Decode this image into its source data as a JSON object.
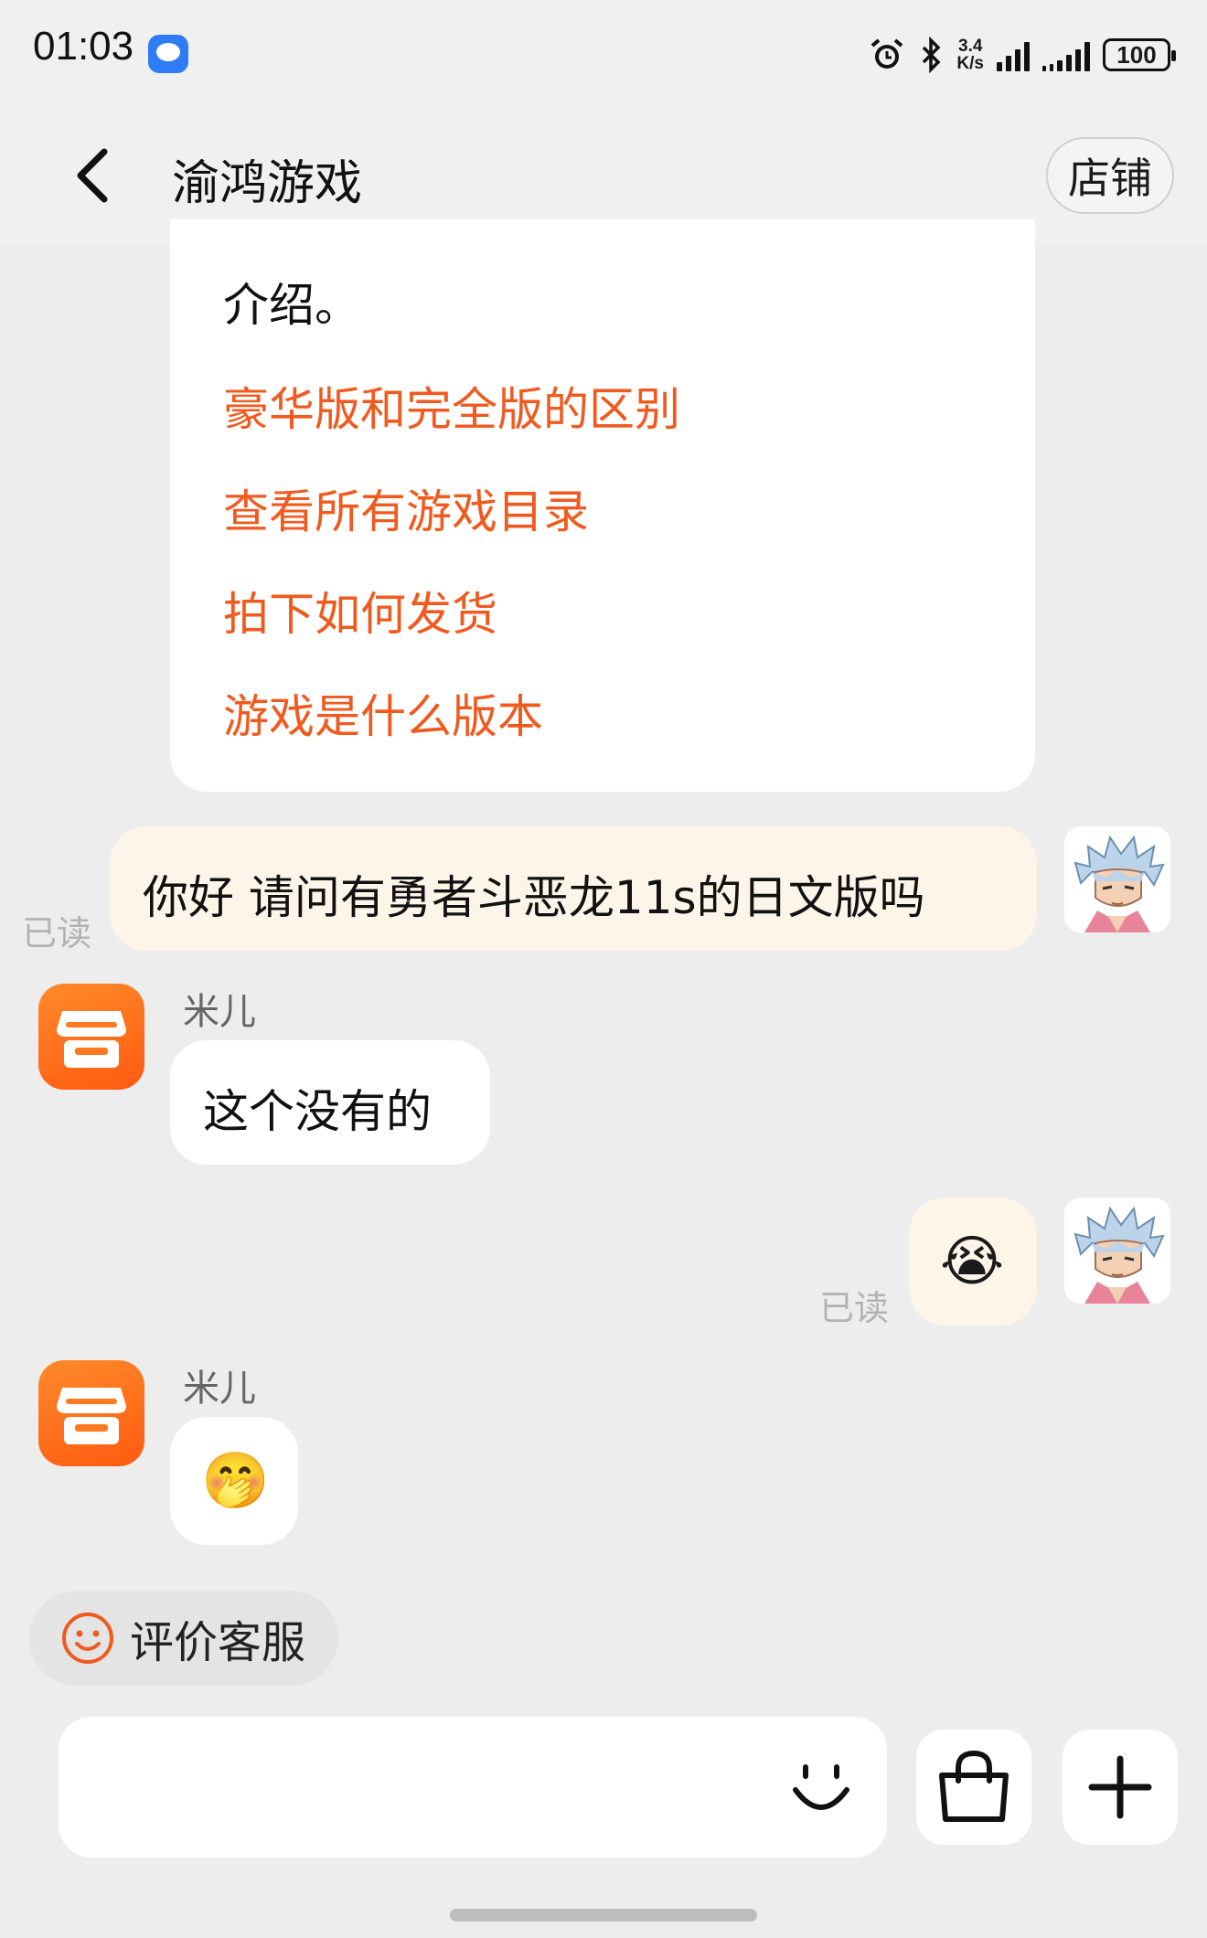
{
  "status_bar": {
    "time": "01:03",
    "net_rate_value": "3.4",
    "net_rate_unit": "K/s",
    "battery": "100"
  },
  "header": {
    "title": "渝鸿游戏",
    "shop_button": "店铺"
  },
  "card": {
    "text_tail": "介绍。",
    "links": [
      "豪华版和完全版的区别",
      "查看所有游戏目录",
      "拍下如何发货",
      "游戏是什么版本"
    ]
  },
  "messages": {
    "user_1": {
      "text": "你好 请问有勇者斗恶龙11s的日文版吗",
      "status": "已读"
    },
    "shop_1": {
      "sender": "米儿",
      "text": "这个没有的"
    },
    "user_2": {
      "emoji": "😭",
      "status": "已读"
    },
    "shop_2": {
      "sender": "米儿",
      "emoji": "🤭"
    }
  },
  "rate_button": {
    "label": "评价客服"
  },
  "colors": {
    "link": "#f05a1e",
    "shop_avatar": "#ff6a14",
    "user_bubble": "#fdf5e8",
    "background": "#ededed"
  }
}
